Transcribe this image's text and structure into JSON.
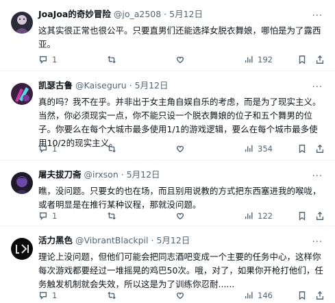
{
  "tweets": [
    {
      "name": "JoaJoa的奇妙冒险",
      "handle": "@jo_a2508",
      "time": "· 5月12日",
      "text": "这其实很正常也很公平。只要直男们还能选择女脱衣舞娘，哪怕是为了露西亚。",
      "replies": "1",
      "views": "192"
    },
    {
      "name": "凯瑟古鲁",
      "handle": "@Kaiseguru",
      "time": "· 5月12日",
      "text": "真的吗？我不在乎。并非出于女主角自娱自乐的考虑，而是为了现实主义。当然，你必须现实一点，你不能只设一个脱衣舞娘的位子和五个舞男的位子。你要么在每个大城市最多使用1/1的游戏逻辑，要么在每个城市最多使用10/2的现实主义。",
      "replies": "1",
      "views": "354"
    },
    {
      "name": "屠夫拔刀斋",
      "handle": "@irxson",
      "time": "· 5月12日",
      "text": "瞧，没问题。只要女的也在场，而且别用说教的方式把东西塞进我的喉咙，或者明显是在推行某种议程，那就没问题。",
      "replies": "1",
      "views": "122"
    },
    {
      "name": "活力黑色",
      "handle": "@VibrantBlackpil",
      "time": "· 5月12日",
      "text": "理论上没问题，但他们可能会把同志酒吧变成一个主要的任务中心，这样你每次游戏都要经过一堆摇晃的鸡巴50次。哦，对了，如果你开枪打他们，任务触发机制就会失效，所以这是为了训练你忍耐......",
      "replies": "1",
      "views": "146"
    }
  ],
  "more_label": "···",
  "colors": {
    "icon": "#536471",
    "divider": "#eff3f4"
  }
}
